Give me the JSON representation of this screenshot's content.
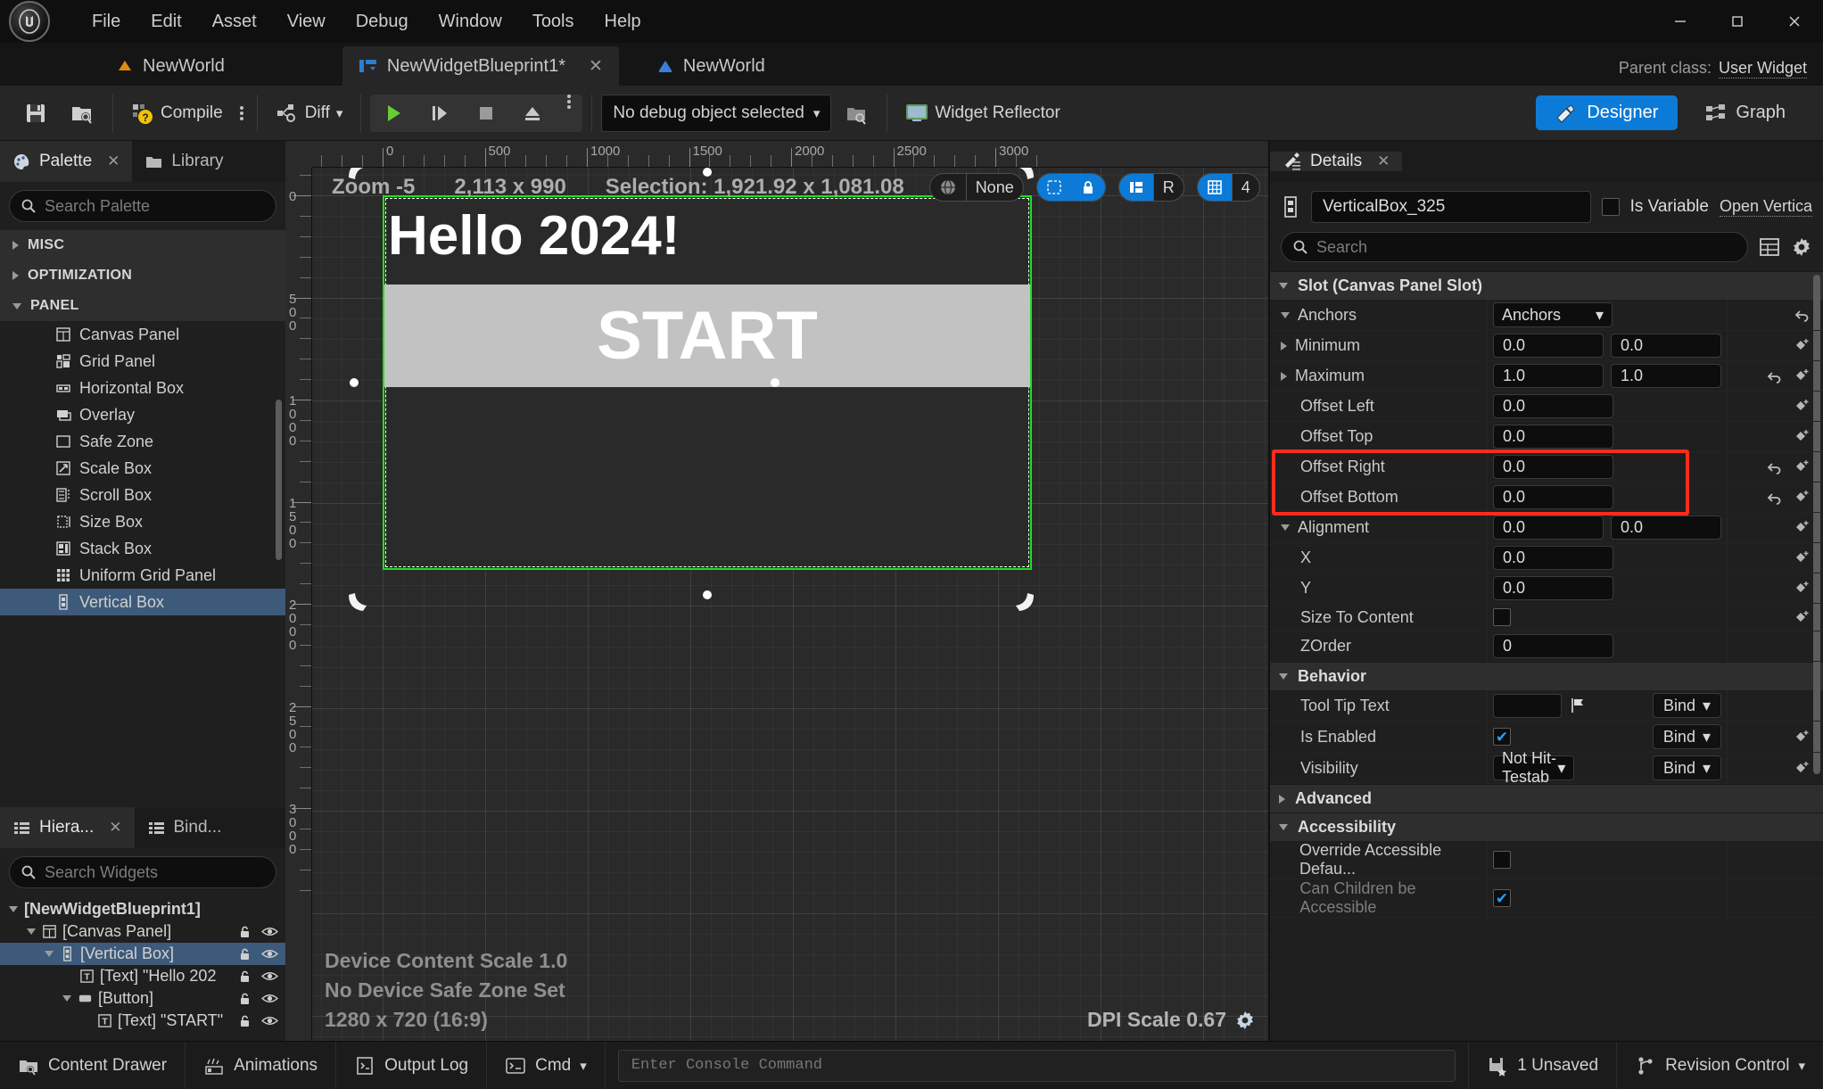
{
  "window": {
    "minimize_label": "–",
    "maximize_label": "□",
    "close_label": "✕"
  },
  "menu": {
    "items": [
      "File",
      "Edit",
      "Asset",
      "View",
      "Debug",
      "Window",
      "Tools",
      "Help"
    ]
  },
  "asset_tabs": [
    {
      "label": "NewWorld",
      "icon": "level-icon",
      "active": false
    },
    {
      "label": "NewWidgetBlueprint1*",
      "icon": "widget-blueprint-icon",
      "active": true,
      "closable": true
    },
    {
      "label": "NewWorld",
      "icon": "world-icon",
      "active": false
    }
  ],
  "parent_class": {
    "label": "Parent class:",
    "value": "User Widget"
  },
  "toolbar": {
    "save_icon": "save-icon",
    "browse_icon": "browse-content-icon",
    "compile_label": "Compile",
    "compile_icon": "compile-question-icon",
    "diff_label": "Diff",
    "play_icon": "play-icon",
    "step_icon": "step-icon",
    "stop_icon": "stop-icon",
    "eject_icon": "eject-icon",
    "debug_object": "No debug object selected",
    "debug_browse_icon": "browse-icon",
    "widget_reflector_label": "Widget Reflector",
    "designer_label": "Designer",
    "graph_label": "Graph",
    "active_mode": "Designer",
    "accent_color": "#0c7bd8"
  },
  "palette": {
    "tabs": [
      {
        "label": "Palette",
        "icon": "palette-icon",
        "active": true,
        "closable": true
      },
      {
        "label": "Library",
        "icon": "folder-icon",
        "active": false
      }
    ],
    "search_placeholder": "Search Palette",
    "search_value": "",
    "categories": [
      {
        "label": "MISC",
        "expanded": false
      },
      {
        "label": "OPTIMIZATION",
        "expanded": false
      },
      {
        "label": "PANEL",
        "expanded": true
      }
    ],
    "panel_items": [
      {
        "label": "Canvas Panel",
        "icon": "canvas-panel-icon",
        "selected": false
      },
      {
        "label": "Grid Panel",
        "icon": "grid-panel-icon",
        "selected": false
      },
      {
        "label": "Horizontal Box",
        "icon": "horizontal-box-icon",
        "selected": false
      },
      {
        "label": "Overlay",
        "icon": "overlay-icon",
        "selected": false
      },
      {
        "label": "Safe Zone",
        "icon": "safe-zone-icon",
        "selected": false
      },
      {
        "label": "Scale Box",
        "icon": "scale-box-icon",
        "selected": false
      },
      {
        "label": "Scroll Box",
        "icon": "scroll-box-icon",
        "selected": false
      },
      {
        "label": "Size Box",
        "icon": "size-box-icon",
        "selected": false
      },
      {
        "label": "Stack Box",
        "icon": "stack-box-icon",
        "selected": false
      },
      {
        "label": "Uniform Grid Panel",
        "icon": "uniform-grid-icon",
        "selected": false
      },
      {
        "label": "Vertical Box",
        "icon": "vertical-box-icon",
        "selected": true
      }
    ]
  },
  "hierarchy": {
    "tabs": [
      {
        "label": "Hiera...",
        "icon": "list-icon",
        "active": true,
        "closable": true
      },
      {
        "label": "Bind...",
        "icon": "list-icon",
        "active": false
      }
    ],
    "search_placeholder": "Search Widgets",
    "search_value": "",
    "rows": [
      {
        "label": "[NewWidgetBlueprint1]",
        "depth": 0,
        "expander": "down",
        "icon": "",
        "bold": true,
        "selected": false,
        "lock": false,
        "eye": false
      },
      {
        "label": "[Canvas Panel]",
        "depth": 1,
        "expander": "down",
        "icon": "canvas-panel-icon",
        "bold": false,
        "selected": false,
        "lock": true,
        "eye": true
      },
      {
        "label": "[Vertical Box]",
        "depth": 2,
        "expander": "down",
        "icon": "vertical-box-icon",
        "bold": false,
        "selected": true,
        "lock": true,
        "eye": true
      },
      {
        "label": "[Text] \"Hello 202",
        "depth": 3,
        "expander": "none",
        "icon": "text-icon",
        "bold": false,
        "selected": false,
        "lock": true,
        "eye": true
      },
      {
        "label": "[Button]",
        "depth": 3,
        "expander": "down",
        "icon": "button-icon",
        "bold": false,
        "selected": false,
        "lock": true,
        "eye": true
      },
      {
        "label": "[Text] \"START\"",
        "depth": 4,
        "expander": "none",
        "icon": "text-icon",
        "bold": false,
        "selected": false,
        "lock": true,
        "eye": true
      }
    ]
  },
  "designer": {
    "zoom_label": "Zoom -5",
    "resolution_label": "2,113 x 990",
    "selection_label": "Selection: 1,921.92 x 1,081.08",
    "globe_value": "None",
    "grid_snap_value": "4",
    "pill_locked_icon": "lock-icon",
    "pill_marquee_icon": "marquee-icon",
    "pill_layout_icon": "layout-icon",
    "pill_r_label": "R",
    "pill_grid_icon": "grid-icon",
    "ruler_h_ticks": [
      0,
      500,
      1000,
      1500,
      2000
    ],
    "ruler_v_ticks": [
      0,
      500,
      1000,
      1500,
      2000
    ],
    "preview": {
      "title_text": "Hello 2024!",
      "button_text": "START",
      "button_color": "#c2c2c2",
      "selection_color": "#1ee11e"
    },
    "footer": {
      "device_content_scale": "Device Content Scale 1.0",
      "safe_zone": "No Device Safe Zone Set",
      "resolution": "1280 x 720 (16:9)",
      "dpi_scale": "DPI Scale 0.67",
      "settings_icon": "gear-icon"
    }
  },
  "details": {
    "tab_label": "Details",
    "tab_icon": "details-icon",
    "tab_close": "✕",
    "object_icon": "vertical-box-icon",
    "object_name": "VerticalBox_325",
    "is_variable_label": "Is Variable",
    "is_variable_checked": false,
    "open_link": "Open Vertica",
    "search_placeholder": "Search",
    "search_value": "",
    "column_icon": "columns-icon",
    "settings_icon": "gear-icon",
    "sections": [
      {
        "name": "Slot (Canvas Panel Slot)",
        "expanded": true,
        "rows": [
          {
            "label": "Anchors",
            "type": "dropdown",
            "value": "Anchors",
            "expander": "down",
            "indent": 0,
            "revert": true,
            "diamond": false
          },
          {
            "label": "Minimum",
            "type": "vector2",
            "values": [
              "0.0",
              "0.0"
            ],
            "expander": "right",
            "indent": 1,
            "revert": false,
            "diamond": true
          },
          {
            "label": "Maximum",
            "type": "vector2",
            "values": [
              "1.0",
              "1.0"
            ],
            "expander": "right",
            "indent": 1,
            "revert": true,
            "diamond": true
          },
          {
            "label": "Offset Left",
            "type": "number",
            "value": "0.0",
            "expander": "none",
            "indent": 1,
            "revert": false,
            "diamond": true
          },
          {
            "label": "Offset Top",
            "type": "number",
            "value": "0.0",
            "expander": "none",
            "indent": 1,
            "revert": false,
            "diamond": true
          },
          {
            "label": "Offset Right",
            "type": "number",
            "value": "0.0",
            "expander": "none",
            "indent": 1,
            "revert": true,
            "diamond": true,
            "highlighted": true
          },
          {
            "label": "Offset Bottom",
            "type": "number",
            "value": "0.0",
            "expander": "none",
            "indent": 1,
            "revert": true,
            "diamond": true,
            "highlighted": true
          },
          {
            "label": "Alignment",
            "type": "vector2",
            "values": [
              "0.0",
              "0.0"
            ],
            "expander": "down",
            "indent": 0,
            "revert": false,
            "diamond": true
          },
          {
            "label": "X",
            "type": "number",
            "value": "0.0",
            "expander": "none",
            "indent": 2,
            "revert": false,
            "diamond": true
          },
          {
            "label": "Y",
            "type": "number",
            "value": "0.0",
            "expander": "none",
            "indent": 2,
            "revert": false,
            "diamond": true
          },
          {
            "label": "Size To Content",
            "type": "checkbox",
            "checked": false,
            "expander": "none",
            "indent": 1,
            "revert": false,
            "diamond": true
          },
          {
            "label": "ZOrder",
            "type": "number",
            "value": "0",
            "expander": "none",
            "indent": 1,
            "revert": false,
            "diamond": false
          }
        ]
      },
      {
        "name": "Behavior",
        "expanded": true,
        "rows": [
          {
            "label": "Tool Tip Text",
            "type": "text_bind",
            "value": "",
            "bind_label": "Bind",
            "flag_icon": "flag-icon",
            "expander": "none",
            "indent": 1,
            "revert": false,
            "diamond": false
          },
          {
            "label": "Is Enabled",
            "type": "checkbox_bind",
            "checked": true,
            "bind_label": "Bind",
            "expander": "none",
            "indent": 1,
            "revert": false,
            "diamond": true
          },
          {
            "label": "Visibility",
            "type": "dropdown_bind",
            "value": "Not Hit-Testab",
            "bind_label": "Bind",
            "expander": "none",
            "indent": 1,
            "revert": false,
            "diamond": true
          }
        ]
      },
      {
        "name": "Advanced",
        "expanded": false,
        "rows": []
      },
      {
        "name": "Accessibility",
        "expanded": true,
        "rows": [
          {
            "label": "Override Accessible Defau...",
            "type": "checkbox",
            "checked": false,
            "expander": "none",
            "indent": 1,
            "revert": false,
            "diamond": false
          },
          {
            "label": "Can Children be Accessible",
            "type": "checkbox",
            "checked": true,
            "expander": "none",
            "indent": 1,
            "revert": false,
            "diamond": false,
            "dimmed": true
          }
        ]
      }
    ],
    "highlight_color": "#fd2b1b"
  },
  "statusbar": {
    "content_drawer": "Content Drawer",
    "animations": "Animations",
    "output_log": "Output Log",
    "cmd_label": "Cmd",
    "console_placeholder": "Enter Console Command",
    "console_value": "",
    "unsaved": "1 Unsaved",
    "revision_control": "Revision Control"
  }
}
